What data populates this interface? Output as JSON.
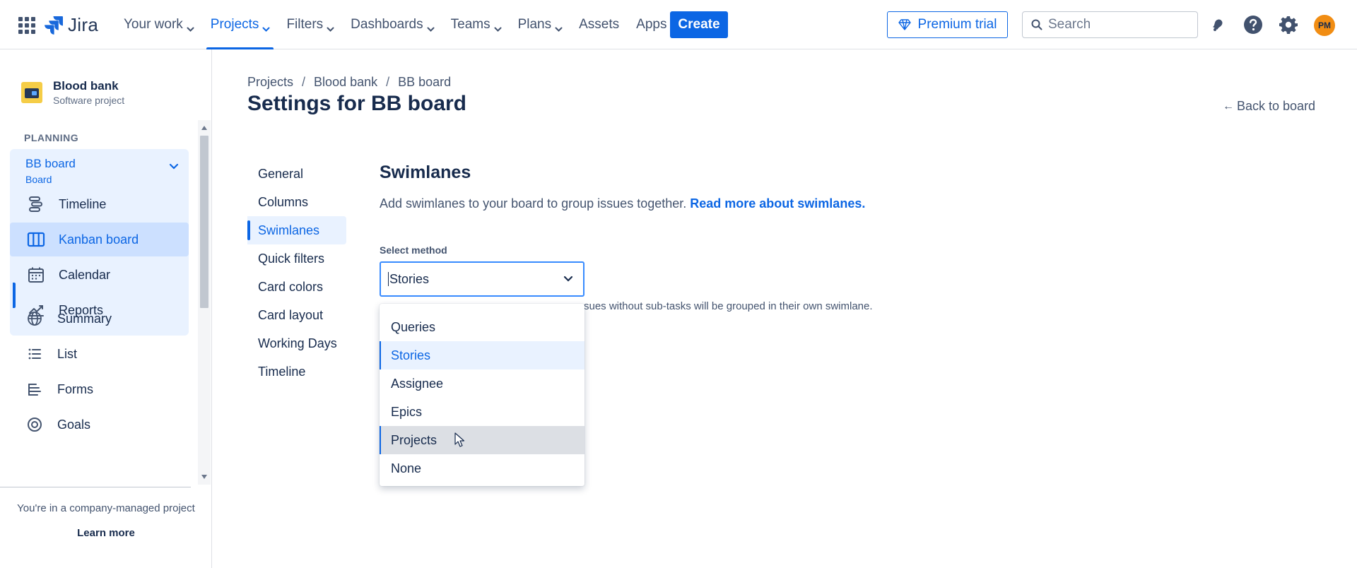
{
  "topnav": {
    "logo_text": "Jira",
    "items": [
      {
        "label": "Your work",
        "has_chevron": true
      },
      {
        "label": "Projects",
        "has_chevron": true,
        "active": true
      },
      {
        "label": "Filters",
        "has_chevron": true
      },
      {
        "label": "Dashboards",
        "has_chevron": true
      },
      {
        "label": "Teams",
        "has_chevron": true
      },
      {
        "label": "Plans",
        "has_chevron": true
      },
      {
        "label": "Assets",
        "has_chevron": false
      },
      {
        "label": "Apps",
        "has_chevron": true
      }
    ],
    "create_label": "Create",
    "premium_label": "Premium trial",
    "search_placeholder": "Search",
    "avatar_initials": "PM",
    "accent": "#0c66e4"
  },
  "sidebar": {
    "project_name": "Blood bank",
    "project_type": "Software project",
    "planning_label": "PLANNING",
    "board_name": "BB board",
    "board_sub": "Board",
    "planning_items": [
      {
        "label": "Timeline",
        "icon": "timeline-icon"
      },
      {
        "label": "Kanban board",
        "icon": "kanban-board-icon",
        "active": true
      },
      {
        "label": "Calendar",
        "icon": "calendar-icon"
      },
      {
        "label": "Reports",
        "icon": "reports-icon"
      }
    ],
    "other_items": [
      {
        "label": "Summary",
        "icon": "globe-icon"
      },
      {
        "label": "List",
        "icon": "list-icon"
      },
      {
        "label": "Forms",
        "icon": "forms-icon"
      },
      {
        "label": "Goals",
        "icon": "goals-icon"
      }
    ],
    "company_note": "You're in a company-managed project",
    "learn_more": "Learn more"
  },
  "main": {
    "breadcrumb": [
      "Projects",
      "Blood bank",
      "BB board"
    ],
    "title": "Settings for BB board",
    "back_label": "Back to board",
    "settings_nav": [
      {
        "label": "General"
      },
      {
        "label": "Columns"
      },
      {
        "label": "Swimlanes",
        "active": true
      },
      {
        "label": "Quick filters"
      },
      {
        "label": "Card colors"
      },
      {
        "label": "Card layout"
      },
      {
        "label": "Working Days"
      },
      {
        "label": "Timeline"
      }
    ],
    "section_title": "Swimlanes",
    "section_desc": "Add swimlanes to your board to group issues together.",
    "section_link": "Read more about swimlanes",
    "field_label": "Select method",
    "selected_value": "Stories",
    "help_text": "sues without sub-tasks will be grouped in their own swimlane.",
    "options": [
      {
        "label": "Queries"
      },
      {
        "label": "Stories",
        "selected": true
      },
      {
        "label": "Assignee"
      },
      {
        "label": "Epics"
      },
      {
        "label": "Projects",
        "hovered": true
      },
      {
        "label": "None"
      }
    ]
  }
}
